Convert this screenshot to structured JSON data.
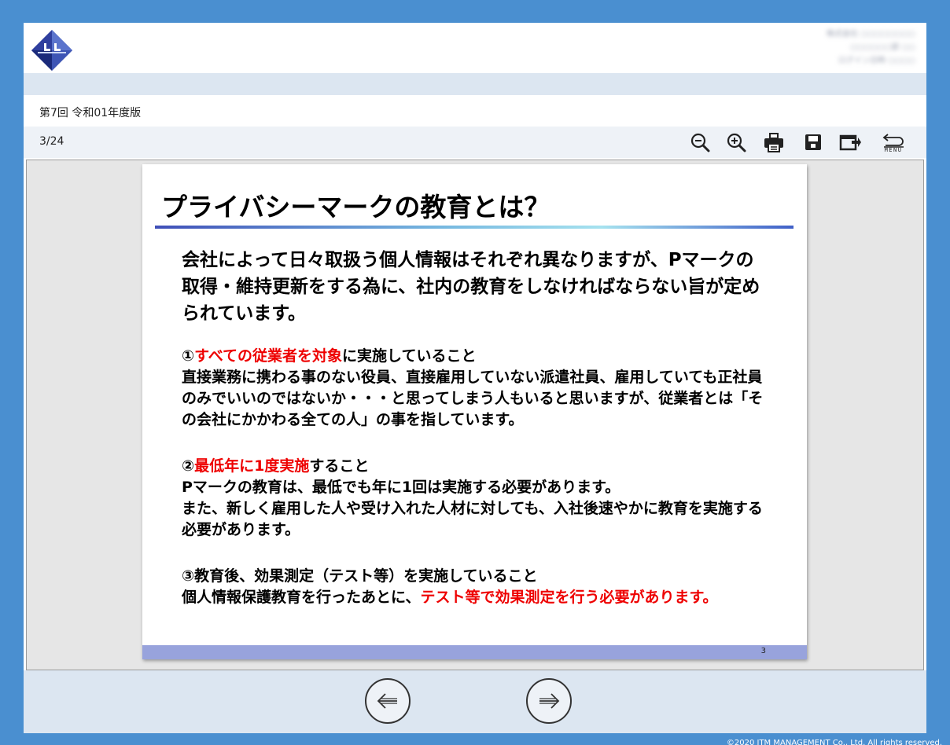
{
  "header": {
    "user_info_lines": [
      "株式会社 ○○○○○○○○",
      "○○○○○○部 ○○",
      "ログイン日時 ○○○○"
    ]
  },
  "document": {
    "title": "第7回 令和01年度版",
    "page_counter": "3/24"
  },
  "toolbar": {
    "menu_label": "MENU",
    "icons": [
      "zoom-out-icon",
      "zoom-in-icon",
      "print-icon",
      "save-icon",
      "export-icon",
      "menu-return-icon"
    ]
  },
  "slide": {
    "title": "プライバシーマークの教育とは？",
    "intro": "会社によって日々取扱う個人情報はそれぞれ異なりますが、Pマークの取得・維持更新をする為に、社内の教育をしなければならない旨が定められています。",
    "sections": [
      {
        "heading_prefix": "①",
        "heading_red": "すべての従業者を対象",
        "heading_suffix": "に実施していること",
        "body": "直接業務に携わる事のない役員、直接雇用していない派遣社員、雇用していても正社員のみでいいのではないか・・・と思ってしまう人もいると思いますが、従業者とは「その会社にかかわる全ての人」の事を指しています。"
      },
      {
        "heading_prefix": "②",
        "heading_red": "最低年に1度実施",
        "heading_suffix": "すること",
        "body": "Pマークの教育は、最低でも年に1回は実施する必要があります。\nまた、新しく雇用した人や受け入れた人材に対しても、入社後速やかに教育を実施する必要があります。"
      },
      {
        "heading": "③教育後、効果測定（テスト等）を実施していること",
        "body_black": "個人情報保護教育を行ったあとに、",
        "body_red": "テスト等で効果測定を行う必要があります。"
      }
    ],
    "page_number": "3"
  },
  "navigation": {
    "prev_icon": "left-arrow-icon",
    "next_icon": "right-arrow-icon"
  },
  "footer": {
    "copyright": "©2020 JTM MANAGEMENT Co., Ltd. All rights reserved."
  },
  "colors": {
    "background": "#4a8fd0",
    "band": "#dce6f1",
    "highlight_red": "#ee0000",
    "slide_footer": "#98a3dc"
  }
}
